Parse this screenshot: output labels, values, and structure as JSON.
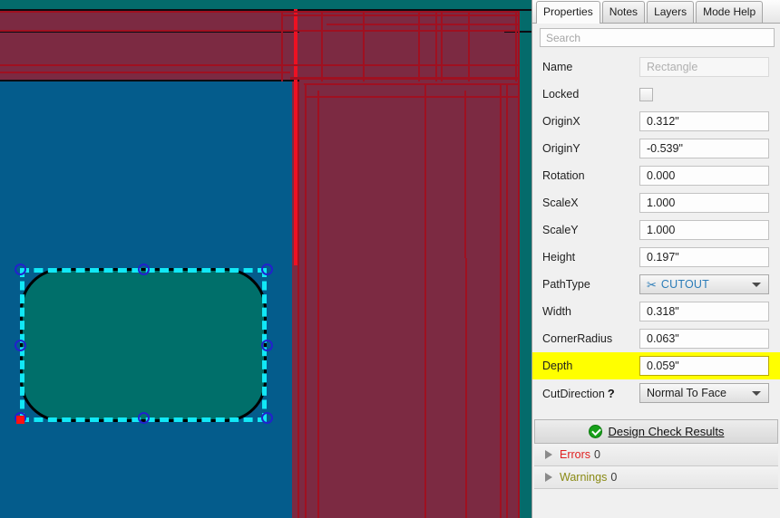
{
  "canvas": {
    "selected_object": "rounded-rectangle",
    "colors": {
      "background_blue": "#045c8c",
      "material_teal": "#046b6b",
      "pocket_maroon": "#7c2a42",
      "shape_fill_teal": "#006f6a",
      "selection_cyan": "#11e8f6",
      "handle_blue": "#2222cc",
      "origin_red": "#ff1111",
      "toolpath_red": "#a01020"
    }
  },
  "panel": {
    "tabs": [
      {
        "label": "Properties",
        "active": true
      },
      {
        "label": "Notes",
        "active": false
      },
      {
        "label": "Layers",
        "active": false
      },
      {
        "label": "Mode Help",
        "active": false
      }
    ],
    "search": {
      "value": "",
      "placeholder": "Search"
    },
    "properties": [
      {
        "label": "Name",
        "type": "text",
        "value": "Rectangle",
        "placeholder": true,
        "highlight": false
      },
      {
        "label": "Locked",
        "type": "checkbox",
        "value": "",
        "checked": false,
        "highlight": false
      },
      {
        "label": "OriginX",
        "type": "text",
        "value": "0.312\"",
        "placeholder": false,
        "highlight": false
      },
      {
        "label": "OriginY",
        "type": "text",
        "value": "-0.539\"",
        "placeholder": false,
        "highlight": false
      },
      {
        "label": "Rotation",
        "type": "text",
        "value": "0.000",
        "placeholder": false,
        "highlight": false
      },
      {
        "label": "ScaleX",
        "type": "text",
        "value": "1.000",
        "placeholder": false,
        "highlight": false
      },
      {
        "label": "ScaleY",
        "type": "text",
        "value": "1.000",
        "placeholder": false,
        "highlight": false
      },
      {
        "label": "Height",
        "type": "text",
        "value": "0.197\"",
        "placeholder": false,
        "highlight": false
      },
      {
        "label": "PathType",
        "type": "combo",
        "value": "CUTOUT",
        "icon": "scissors-icon",
        "highlight": false
      },
      {
        "label": "Width",
        "type": "text",
        "value": "0.318\"",
        "placeholder": false,
        "highlight": false
      },
      {
        "label": "CornerRadius",
        "type": "text",
        "value": "0.063\"",
        "placeholder": false,
        "highlight": false
      },
      {
        "label": "Depth",
        "type": "text",
        "value": "0.059\"",
        "placeholder": false,
        "highlight": true
      },
      {
        "label": "CutDirection",
        "type": "combo",
        "value": "Normal To Face",
        "help": "?",
        "highlight": false
      }
    ],
    "design_check": {
      "title": "Design Check Results",
      "status_icon": "green-check-icon",
      "rows": [
        {
          "label": "Errors",
          "count": "0",
          "kind": "err"
        },
        {
          "label": "Warnings",
          "count": "0",
          "kind": "warn"
        }
      ]
    }
  }
}
